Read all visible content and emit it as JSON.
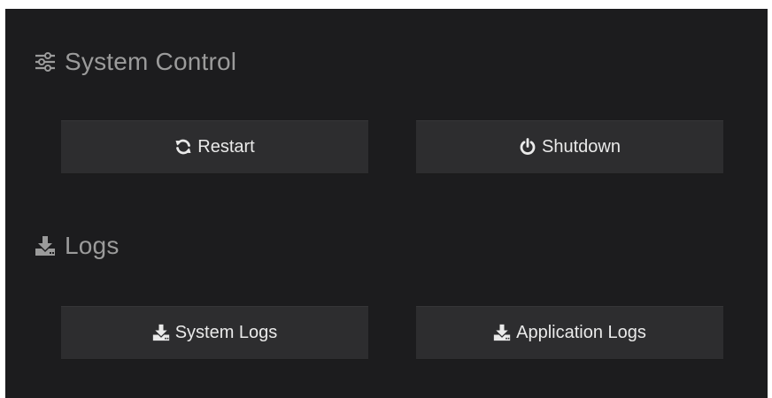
{
  "system_control": {
    "title": "System Control",
    "icon": "sliders-icon",
    "restart_label": "Restart",
    "restart_icon": "refresh-icon",
    "shutdown_label": "Shutdown",
    "shutdown_icon": "power-icon"
  },
  "logs": {
    "title": "Logs",
    "icon": "download-icon",
    "system_logs_label": "System Logs",
    "application_logs_label": "Application Logs"
  },
  "colors": {
    "background": "#1c1c1e",
    "button": "#2d2d2f",
    "heading_text": "#9b9b9b",
    "button_text": "#eaeaea"
  }
}
